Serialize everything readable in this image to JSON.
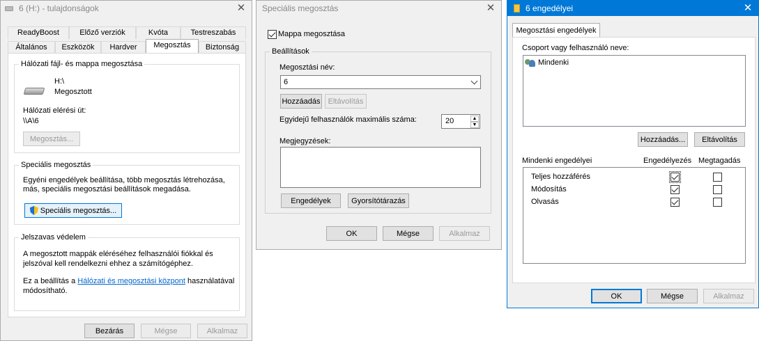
{
  "win1": {
    "title": "6 (H:) - tulajdonságok",
    "tabs_row1": [
      "ReadyBoost",
      "Előző verziók",
      "Kvóta",
      "Testreszabás"
    ],
    "tabs_row2": [
      "Általános",
      "Eszközök",
      "Hardver",
      "Megosztás",
      "Biztonság"
    ],
    "active_tab": "Megosztás",
    "net_share_group": "Hálózati fájl- és mappa megosztása",
    "drive_name": "H:\\",
    "drive_status": "Megosztott",
    "net_path_label": "Hálózati elérési út:",
    "net_path_value": "\\\\A\\6",
    "share_button": "Megosztás...",
    "advanced_group": "Speciális megosztás",
    "advanced_desc1": "Egyéni engedélyek beállítása, több megosztás létrehozása,",
    "advanced_desc2": "más, speciális megosztási beállítások megadása.",
    "advanced_button": "Speciális megosztás...",
    "password_group": "Jelszavas védelem",
    "password_desc1": "A megosztott mappák eléréséhez felhasználói fiókkal és",
    "password_desc2": "jelszóval kell rendelkezni ehhez a számítógéphez.",
    "password_desc3_pre": "Ez a beállítás a ",
    "password_link": "Hálózati és megosztási központ",
    "password_desc3_post": " használatával",
    "password_desc4": "módosítható.",
    "close_button": "Bezárás",
    "cancel_button": "Mégse",
    "apply_button": "Alkalmaz"
  },
  "win2": {
    "title": "Speciális megosztás",
    "share_checkbox": "Mappa megosztása",
    "share_checked": true,
    "settings_group": "Beállítások",
    "share_name_label": "Megosztási név:",
    "share_name_value": "6",
    "add_button": "Hozzáadás",
    "remove_button": "Eltávolítás",
    "max_users_label": "Egyidejű felhasználók maximális száma:",
    "max_users_value": "20",
    "comments_label": "Megjegyzések:",
    "permissions_button": "Engedélyek",
    "caching_button": "Gyorsítótárazás",
    "ok_button": "OK",
    "cancel_button": "Mégse",
    "apply_button": "Alkalmaz"
  },
  "win3": {
    "title": "6 engedélyei",
    "tab": "Megosztási engedélyek",
    "group_label": "Csoport vagy felhasználó neve:",
    "users": [
      "Mindenki"
    ],
    "add_button": "Hozzáadás...",
    "remove_button": "Eltávolítás",
    "perm_header": "Mindenki engedélyei",
    "allow_header": "Engedélyezés",
    "deny_header": "Megtagadás",
    "permissions": [
      {
        "name": "Teljes hozzáférés",
        "allow": true,
        "deny": false
      },
      {
        "name": "Módosítás",
        "allow": true,
        "deny": false
      },
      {
        "name": "Olvasás",
        "allow": true,
        "deny": false
      }
    ],
    "ok_button": "OK",
    "cancel_button": "Mégse",
    "apply_button": "Alkalmaz",
    "accent": "#0078d7"
  }
}
